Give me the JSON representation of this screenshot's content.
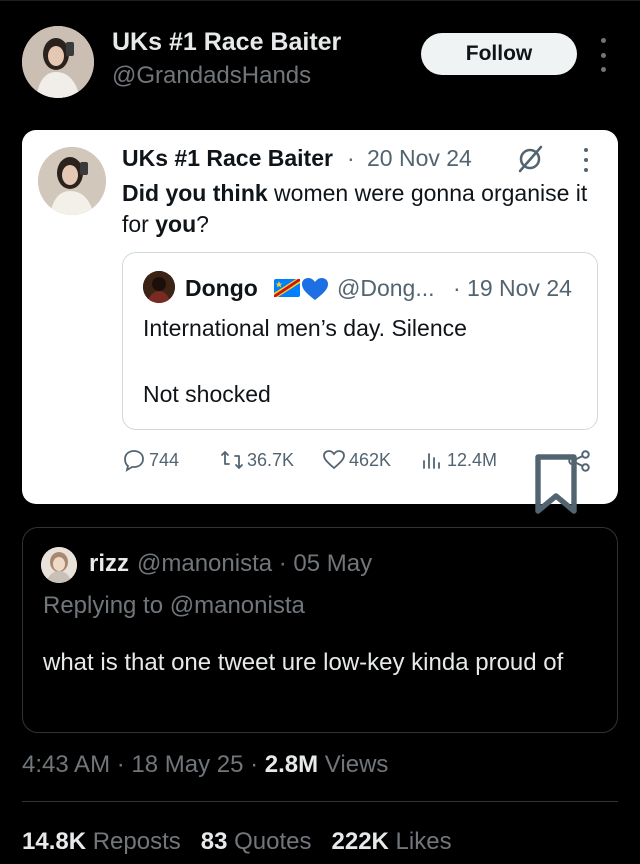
{
  "header": {
    "display_name": "UKs #1 Race Baiter",
    "handle": "@GrandadsHands",
    "follow_label": "Follow",
    "more_icon": "more-vertical-icon"
  },
  "embedded_tweet": {
    "display_name": "UKs #1 Race Baiter",
    "separator": "·",
    "date": "20 Nov 24",
    "text_segments": {
      "bold_1": "Did you think",
      "plain_1": " women were gonna organise it for ",
      "bold_2": "you",
      "plain_2": "?"
    },
    "quoted": {
      "display_name": "Dongo",
      "emoji": [
        "flag-dr-congo",
        "blue-heart"
      ],
      "handle": "@Dong...",
      "date": "· 19 Nov 24",
      "line1": "International men’s day. Silence",
      "line2": "Not shocked"
    },
    "actions": {
      "replies": "744",
      "reposts": "36.7K",
      "likes": "462K",
      "views": "12.4M"
    }
  },
  "quote_card": {
    "display_name": "rizz",
    "handle_date": "@manonista · 05 May",
    "replying_to": "Replying to @manonista",
    "text": "what is that one tweet ure low-key kinda proud of"
  },
  "meta": {
    "time_date": "4:43 AM · 18 May 25 · ",
    "views_count": "2.8M",
    "views_label": " Views"
  },
  "stats": {
    "reposts_count": "14.8K",
    "reposts_label": " Reposts",
    "quotes_count": "83",
    "quotes_label": " Quotes",
    "likes_count": "222K",
    "likes_label": " Likes"
  },
  "colors": {
    "background": "#000000",
    "text_primary": "#e7e9ea",
    "text_secondary": "#71767b",
    "border": "#2f3336",
    "card_white": "#ffffff"
  }
}
